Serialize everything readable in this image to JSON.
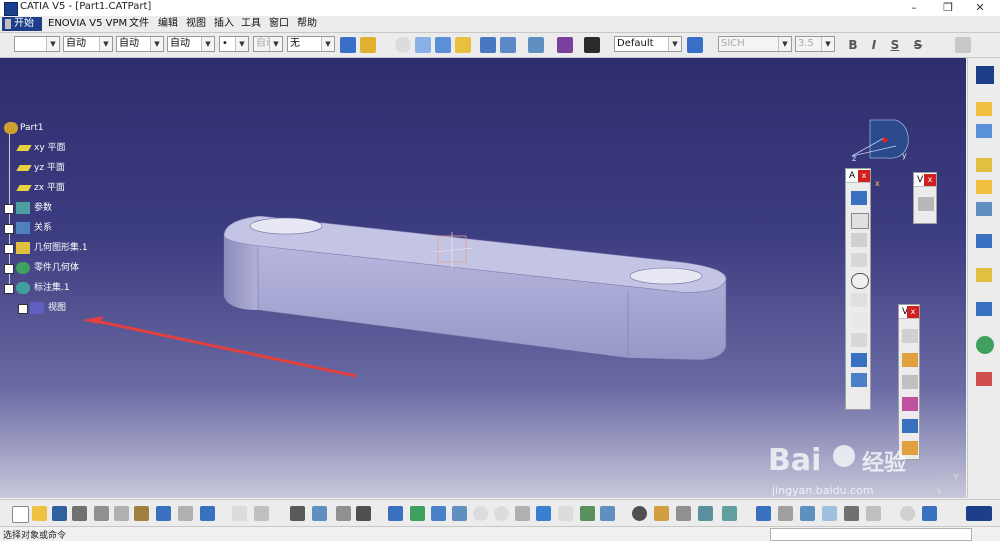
{
  "window": {
    "title": "CATIA V5 - [Part1.CATPart]",
    "minimize": "–",
    "restore": "❐",
    "close": "✕"
  },
  "menu": {
    "start": "开始",
    "items": [
      "ENOVIA V5 VPM",
      "文件",
      "编辑",
      "视图",
      "插入",
      "工具",
      "窗口",
      "帮助"
    ]
  },
  "toolbar": {
    "combo_color": "",
    "combo_linetype": "自动",
    "combo_thickness": "自动",
    "combo_layer": "自动",
    "combo_point": "•",
    "combo_render": "自动",
    "combo_none": "无",
    "combo_style": "Default",
    "combo_font": "SICH",
    "combo_size": "3.5",
    "text_bold": "B",
    "text_italic": "I",
    "text_underline": "S",
    "text_strike": "S"
  },
  "tree": {
    "items": [
      {
        "label": "Part1"
      },
      {
        "label": "xy 平面"
      },
      {
        "label": "yz 平面"
      },
      {
        "label": "zx 平面"
      },
      {
        "label": "参数"
      },
      {
        "label": "关系"
      },
      {
        "label": "几何图形集.1"
      },
      {
        "label": "零件几何体"
      },
      {
        "label": "标注集.1"
      },
      {
        "label": "视图"
      }
    ]
  },
  "panels": {
    "annotations": {
      "title": "A",
      "close": "x"
    },
    "views": {
      "title": "V",
      "close": "x"
    },
    "views2": {
      "title": "V",
      "close": "x"
    }
  },
  "compass": {
    "x_label": "x",
    "y_label": "y",
    "z_label": "z"
  },
  "axis_small": {
    "y_label": "y",
    "x_label": "k"
  },
  "watermark": {
    "brand": "Bai",
    "brand2": "经验",
    "url": "jingyan.baidu.com"
  },
  "status": {
    "text": "选择对象或命令"
  },
  "colors": {
    "accent_start": "#1d3f8a",
    "viewport_top": "#2e2e6e",
    "viewport_bottom": "#c8c8dc",
    "part_face": "#a8a8d8",
    "arrow_red": "#e04040"
  }
}
